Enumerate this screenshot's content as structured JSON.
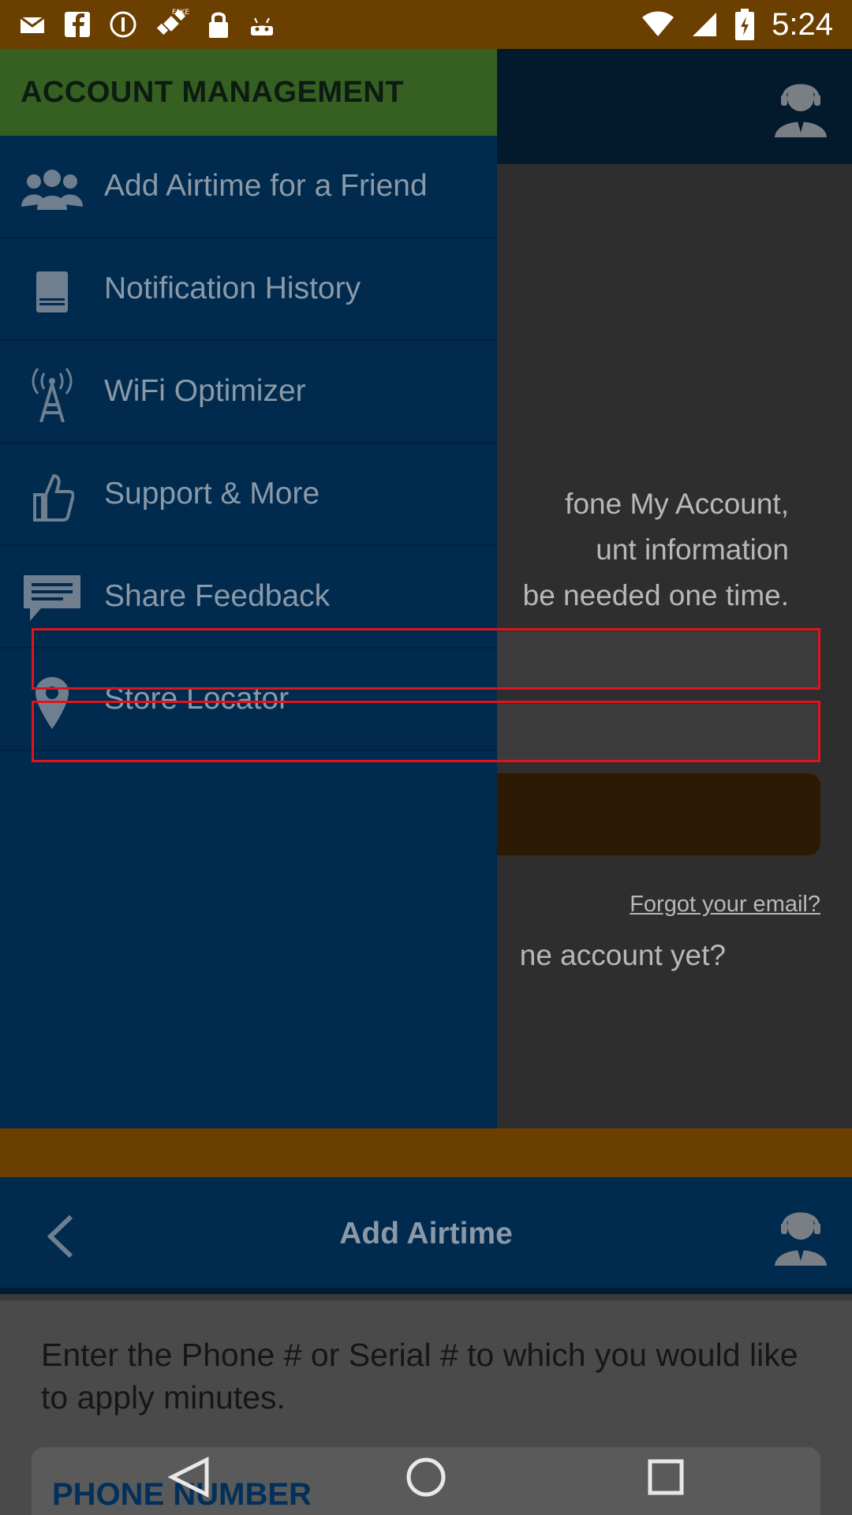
{
  "status_bar": {
    "time": "5:24",
    "icons": [
      "mail-icon",
      "facebook-icon",
      "info-icon",
      "fake-gps-icon",
      "lock-icon",
      "android-icon",
      "wifi-icon",
      "signal-icon",
      "battery-icon"
    ]
  },
  "background_screen": {
    "login_text_lines": [
      "fone My Account,",
      "unt information",
      "be needed one time."
    ],
    "forgot_link": "Forgot your email?",
    "no_account_text": "ne account yet?"
  },
  "drawer": {
    "header_title": "ACCOUNT MANAGEMENT",
    "items": [
      {
        "label": "Add Airtime for a Friend",
        "icon": "group-icon"
      },
      {
        "label": "Notification History",
        "icon": "document-icon"
      },
      {
        "label": "WiFi Optimizer",
        "icon": "tower-icon"
      },
      {
        "label": "Support & More",
        "icon": "thumbs-up-icon"
      },
      {
        "label": "Share Feedback",
        "icon": "chat-icon"
      },
      {
        "label": "Store Locator",
        "icon": "location-pin-icon"
      }
    ]
  },
  "bottom_screen": {
    "title": "Add Airtime",
    "instruction": "Enter the Phone # or Serial # to which you would like to apply minutes.",
    "phone_label": "PHONE NUMBER"
  },
  "colors": {
    "status_bar": "#6b3f00",
    "drawer_bg": "#002a4e",
    "drawer_header": "#365f22",
    "highlight": "#e0141e"
  }
}
